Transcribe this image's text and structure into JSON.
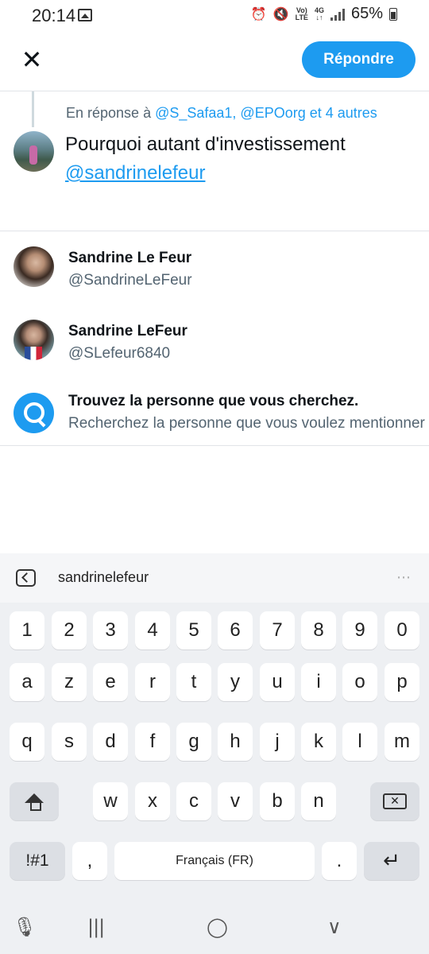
{
  "status_bar": {
    "time": "20:14",
    "network_top": "Vo)",
    "network_bottom": "LTE",
    "data_top": "4G",
    "data_bottom": "↓↑",
    "battery": "65%"
  },
  "header": {
    "reply_button": "Répondre"
  },
  "thread": {
    "in_reply_prefix": "En réponse à ",
    "in_reply_handles": "@S_Safaa1, @EPOorg et 4 autres",
    "compose_text": "Pourquoi autant d'investissement",
    "compose_mention": "@sandrinelefeur"
  },
  "suggestions": [
    {
      "name": "Sandrine Le Feur",
      "handle": "@SandrineLeFeur"
    },
    {
      "name": "Sandrine LeFeur",
      "handle": "@SLefeur6840"
    }
  ],
  "find_person": {
    "title": "Trouvez la personne que vous cherchez.",
    "subtitle": "Recherchez la personne que vous voulez mentionner"
  },
  "keyboard": {
    "suggestion": "sandrinelefeur",
    "more": "⋯",
    "row_numbers": [
      "1",
      "2",
      "3",
      "4",
      "5",
      "6",
      "7",
      "8",
      "9",
      "0"
    ],
    "row1": [
      "a",
      "z",
      "e",
      "r",
      "t",
      "y",
      "u",
      "i",
      "o",
      "p"
    ],
    "row2": [
      "q",
      "s",
      "d",
      "f",
      "g",
      "h",
      "j",
      "k",
      "l",
      "m"
    ],
    "row3": [
      "w",
      "x",
      "c",
      "v",
      "b",
      "n"
    ],
    "symbols_key": "!#1",
    "comma_key": ",",
    "space_label": "Français (FR)",
    "period_key": ".",
    "enter_key": "↵"
  },
  "navbar": {
    "recents": "|||",
    "home": "◯",
    "back": "∨",
    "mic": "🎙"
  },
  "colors": {
    "accent": "#1d9bf0",
    "secondary_text": "#536471"
  }
}
